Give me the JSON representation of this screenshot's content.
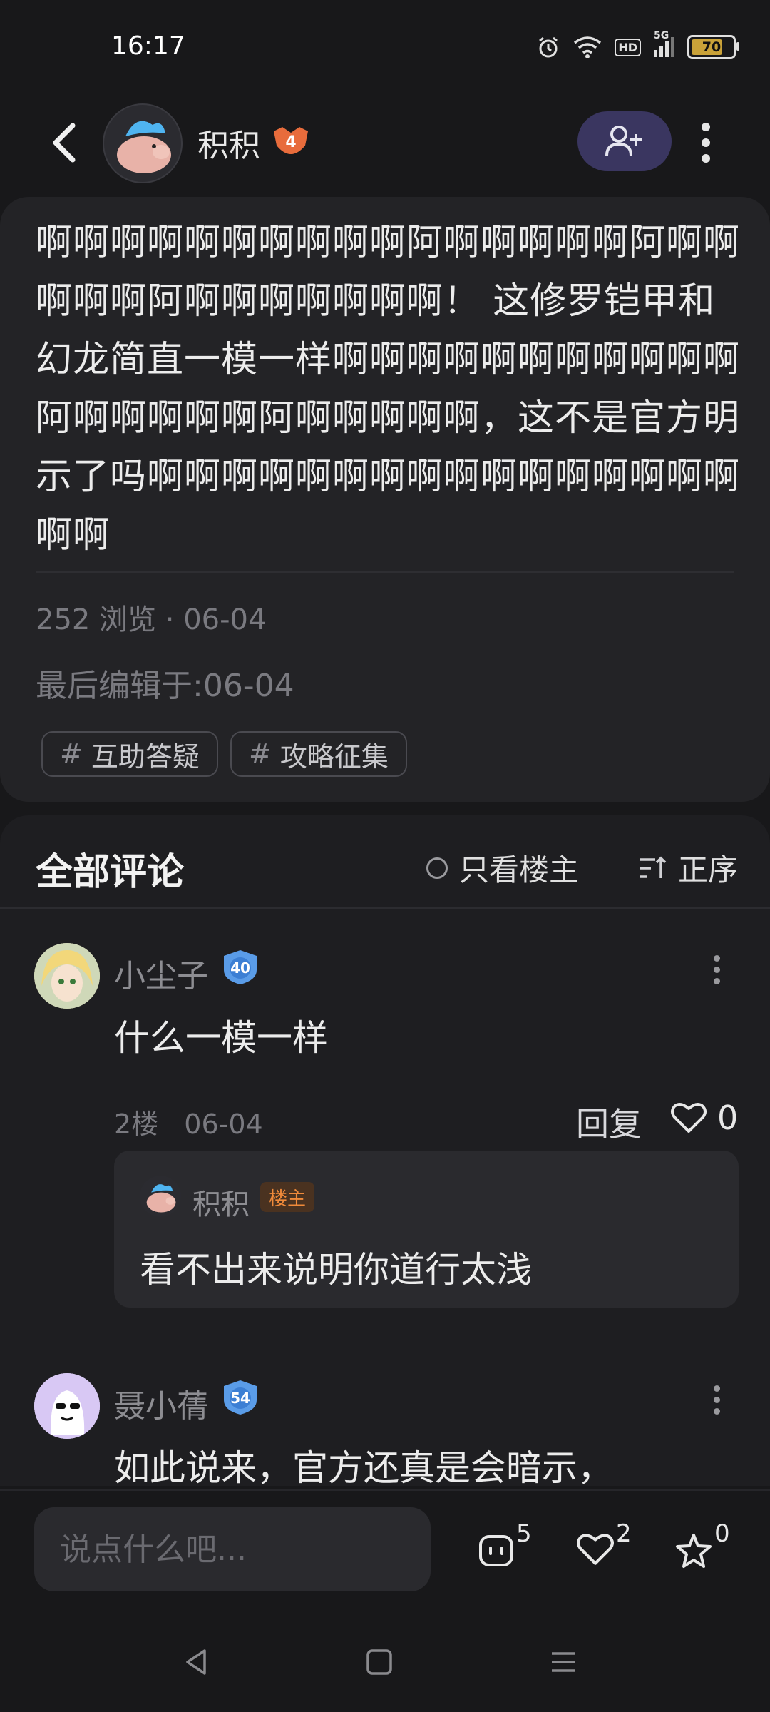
{
  "status_bar": {
    "time": "16:17",
    "icons": [
      "alarm-icon",
      "wifi-icon",
      "hd-icon",
      "5g-signal-icon"
    ],
    "hd_label": "HD",
    "network_label": "5G",
    "battery": "70"
  },
  "header": {
    "username": "积积",
    "level": "4"
  },
  "post": {
    "body": "啊啊啊啊啊啊啊啊啊啊阿啊啊啊啊啊阿啊啊啊啊啊阿啊啊啊啊啊啊啊！ 这修罗铠甲和幻龙简直一模一样啊啊啊啊啊啊啊啊啊啊啊阿啊啊啊啊啊阿啊啊啊啊啊，这不是官方明示了吗啊啊啊啊啊啊啊啊啊啊啊啊啊啊啊啊啊啊",
    "views": "252 浏览 · 06-04",
    "edited": "最后编辑于:06-04",
    "tags": [
      "互助答疑",
      "攻略征集"
    ]
  },
  "comments_section": {
    "title": "全部评论",
    "op_only_label": "只看楼主",
    "sort_label": "正序"
  },
  "comments": [
    {
      "name": "小尘子",
      "level": "40",
      "text": "什么一模一样",
      "floor": "2楼",
      "date": "06-04",
      "reply_label": "回复",
      "likes": "0",
      "reply": {
        "name": "积积",
        "badge": "楼主",
        "text": "看不出来说明你道行太浅"
      }
    },
    {
      "name": "聂小蒨",
      "level": "54",
      "text": "如此说来，官方还真是会暗示，"
    }
  ],
  "bottom_bar": {
    "placeholder": "说点什么吧...",
    "comment_count": "5",
    "like_count": "2",
    "fav_count": "0"
  },
  "colors": {
    "background": "#18181a",
    "card": "#232326",
    "accent": "#3a3660",
    "op_badge": "#f08a3a"
  }
}
